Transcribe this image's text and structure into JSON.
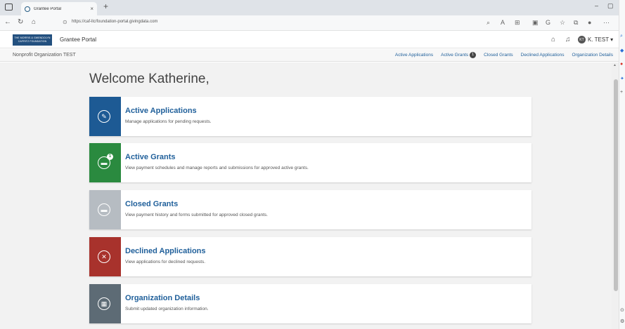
{
  "browser": {
    "tab_title": "Grantee Portal",
    "tab_close": "×",
    "new_tab": "+",
    "url": "https://caf-llc/foundation-portal.givingdata.com",
    "minimize": "–",
    "restore": "▢"
  },
  "header": {
    "logo_text": "THE MORRIS & GWENDOLYN CAFRITZ FOUNDATION",
    "portal_title": "Grantee Portal",
    "user_initials": "KT",
    "user_label": "K. TEST ▾"
  },
  "subnav": {
    "org_name": "Nonprofit Organization TEST",
    "links": [
      {
        "label": "Active Applications"
      },
      {
        "label": "Active Grants",
        "badge": "1"
      },
      {
        "label": "Closed Grants"
      },
      {
        "label": "Declined Applications"
      },
      {
        "label": "Organization Details"
      }
    ]
  },
  "main": {
    "welcome": "Welcome Katherine,",
    "cards": [
      {
        "title": "Active Applications",
        "desc": "Manage applications for pending requests.",
        "color": "#1d5a94",
        "icon": "pencil-icon",
        "glyph": "✎"
      },
      {
        "title": "Active Grants",
        "desc": "View payment schedules and manage reports and submissions for approved active grants.",
        "color": "#2a8a3f",
        "icon": "folder-icon",
        "glyph": "▬",
        "badge": "1"
      },
      {
        "title": "Closed Grants",
        "desc": "View payment history and forms submitted for approved closed grants.",
        "color": "#b6bcc2",
        "icon": "folder-icon",
        "glyph": "▬"
      },
      {
        "title": "Declined Applications",
        "desc": "View applications for declined requests.",
        "color": "#a8322c",
        "icon": "x-circle-icon",
        "glyph": "✕"
      },
      {
        "title": "Organization Details",
        "desc": "Submit updated organization information.",
        "color": "#5d6b75",
        "icon": "building-icon",
        "glyph": "▦"
      }
    ]
  }
}
